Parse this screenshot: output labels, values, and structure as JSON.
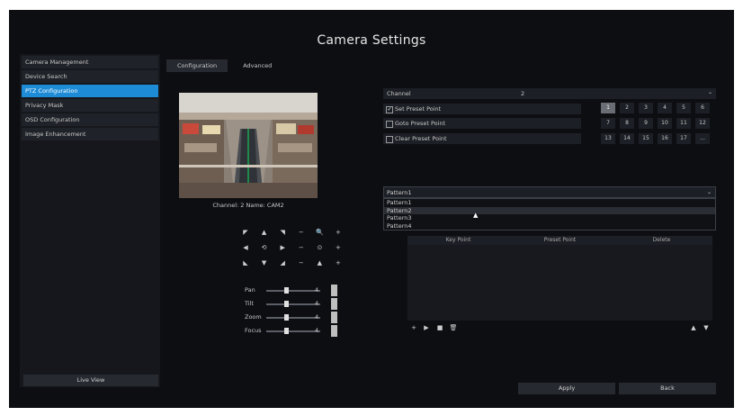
{
  "window": {
    "title": "Camera Settings"
  },
  "sidebar": {
    "items": [
      {
        "label": "Camera Management",
        "active": false
      },
      {
        "label": "Device Search",
        "active": false
      },
      {
        "label": "PTZ Configuration",
        "active": true
      },
      {
        "label": "Privacy Mask",
        "active": false
      },
      {
        "label": "OSD Configuration",
        "active": false
      },
      {
        "label": "Image Enhancement",
        "active": false
      }
    ],
    "live_view_label": "Live View"
  },
  "tabs": [
    {
      "label": "Configuration",
      "active": true
    },
    {
      "label": "Advanced",
      "active": false
    }
  ],
  "preview": {
    "channel_label": "Channel: 2 Name: CAM2"
  },
  "ptz_pad": {
    "row1": [
      "◤",
      "▲",
      "◥",
      "−",
      "🔍",
      "+"
    ],
    "row2": [
      "◀",
      "⟲",
      "▶",
      "−",
      "⊙",
      "+"
    ],
    "row3": [
      "◣",
      "▼",
      "◢",
      "−",
      "▲",
      "+"
    ]
  },
  "sliders": [
    {
      "label": "Pan",
      "value": "4"
    },
    {
      "label": "Tilt",
      "value": "4"
    },
    {
      "label": "Zoom",
      "value": "4"
    },
    {
      "label": "Focus",
      "value": "4"
    }
  ],
  "channel": {
    "label": "Channel",
    "value": "2",
    "arrow": "⌄"
  },
  "preset_options": [
    {
      "label": "Set Preset Point",
      "checked": true
    },
    {
      "label": "Goto Preset Point",
      "checked": false
    },
    {
      "label": "Clear Preset Point",
      "checked": false
    }
  ],
  "preset_grid": [
    "1",
    "2",
    "3",
    "4",
    "5",
    "6",
    "7",
    "8",
    "9",
    "10",
    "11",
    "12",
    "13",
    "14",
    "15",
    "16",
    "17",
    "..."
  ],
  "pattern": {
    "selected": "Pattern1",
    "arrow": "⌄",
    "options": [
      "Pattern1",
      "Pattern2",
      "Pattern3",
      "Pattern4"
    ]
  },
  "table": {
    "headers": [
      "Key Point",
      "Preset Point",
      "Delete"
    ]
  },
  "table_controls": {
    "add": "+",
    "play": "▶",
    "stop": "■",
    "delete": "🗑",
    "up": "▲",
    "down": "▼"
  },
  "footer": {
    "apply_label": "Apply",
    "back_label": "Back"
  },
  "colors": {
    "accent": "#1e8bd6",
    "background": "#0d0e12"
  }
}
